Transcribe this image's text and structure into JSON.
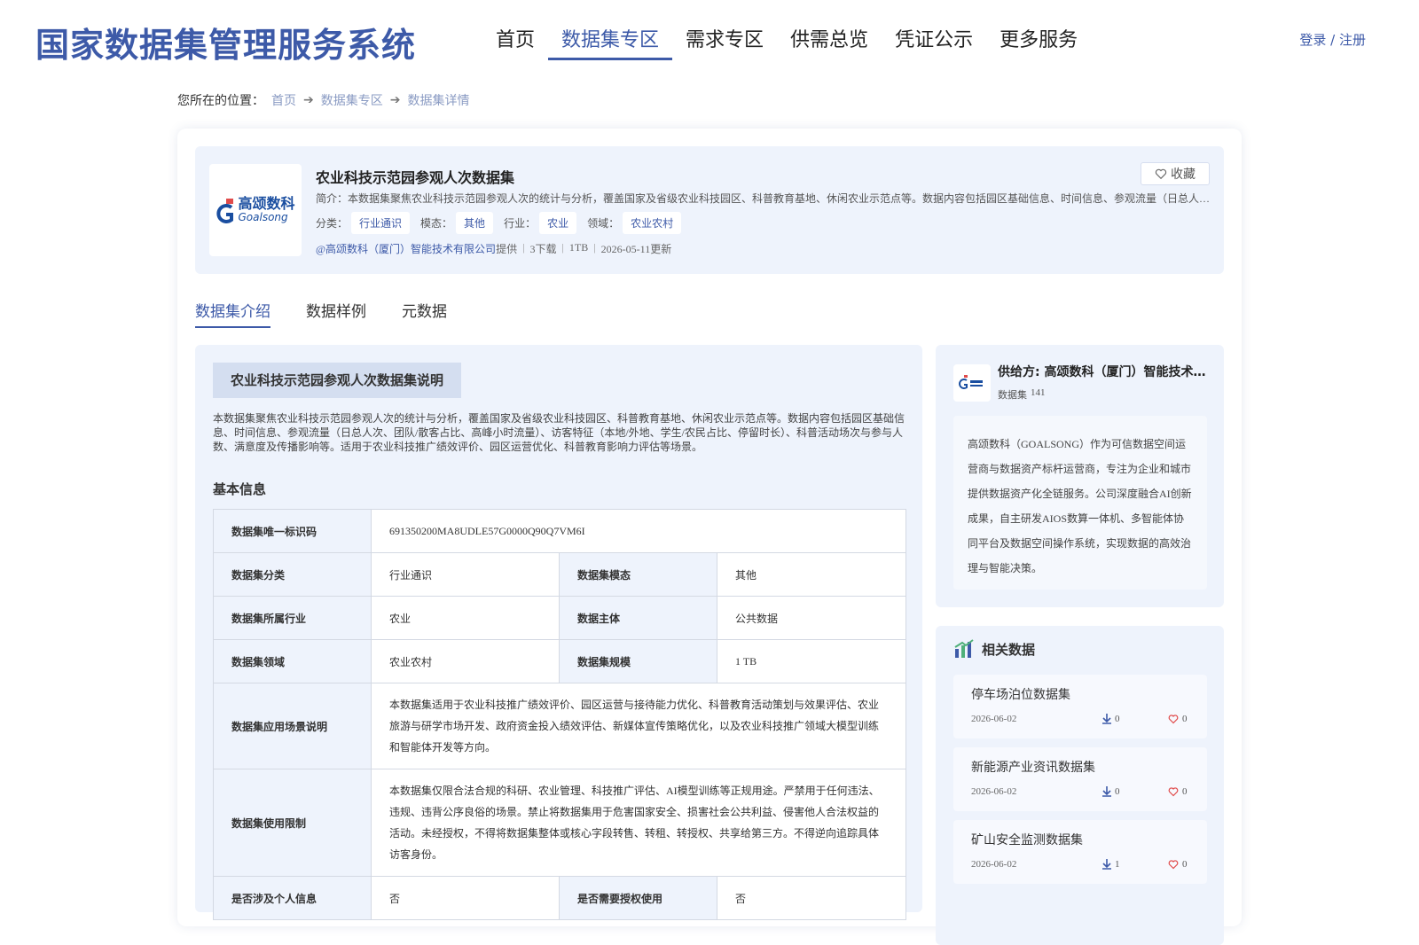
{
  "header": {
    "site_title": "国家数据集管理服务系统",
    "nav": [
      "首页",
      "数据集专区",
      "需求专区",
      "供需总览",
      "凭证公示",
      "更多服务"
    ],
    "active_nav": 1,
    "login": "登录 / 注册"
  },
  "breadcrumb": {
    "prefix": "您所在的位置：",
    "items": [
      "首页",
      "数据集专区",
      "数据集详情"
    ]
  },
  "dataset": {
    "logo_cn": "高颂数科",
    "logo_en": "Goalsong",
    "title": "农业科技示范园参观人次数据集",
    "fav_label": "收藏",
    "intro": "简介：本数据集聚焦农业科技示范园参观人次的统计与分析，覆盖国家及省级农业科技园区、科普教育基地、休闲农业示范点等。数据内容包括园区基础信息、时间信息、参观流量（日总人次、团队/散客占比、高峰小时流量）、访客特征（本地/外地、学生/农民占比、停留时长）、科普活动场次与参与人数、满意度及传播影响等。",
    "tags": [
      {
        "label": "分类：",
        "value": "行业通识"
      },
      {
        "label": "模态：",
        "value": "其他"
      },
      {
        "label": "行业：",
        "value": "农业"
      },
      {
        "label": "领域：",
        "value": "农业农村"
      }
    ],
    "provider": "@高颂数科（厦门）智能技术有限公司",
    "provider_suffix": "提供",
    "downloads": "3下载",
    "size": "1TB",
    "updated": "2026-05-11更新"
  },
  "tabs": [
    "数据集介绍",
    "数据样例",
    "元数据"
  ],
  "active_tab": 0,
  "intro_section": {
    "heading": "农业科技示范园参观人次数据集说明",
    "description": "本数据集聚焦农业科技示范园参观人次的统计与分析，覆盖国家及省级农业科技园区、科普教育基地、休闲农业示范点等。数据内容包括园区基础信息、时间信息、参观流量（日总人次、团队/散客占比、高峰小时流量）、访客特征（本地/外地、学生/农民占比、停留时长）、科普活动场次与参与人数、满意度及传播影响等。适用于农业科技推广绩效评价、园区运营优化、科普教育影响力评估等场景。",
    "basic_title": "基本信息"
  },
  "basic_info": {
    "uid_label": "数据集唯一标识码",
    "uid_value": "691350200MA8UDLE57G0000Q90Q7VM6I",
    "category_label": "数据集分类",
    "category_value": "行业通识",
    "modality_label": "数据集模态",
    "modality_value": "其他",
    "industry_label": "数据集所属行业",
    "industry_value": "农业",
    "subject_label": "数据主体",
    "subject_value": "公共数据",
    "domain_label": "数据集领域",
    "domain_value": "农业农村",
    "scale_label": "数据集规模",
    "scale_value": "1 TB",
    "scenario_label": "数据集应用场景说明",
    "scenario_value": "本数据集适用于农业科技推广绩效评价、园区运营与接待能力优化、科普教育活动策划与效果评估、农业旅游与研学市场开发、政府资金投入绩效评估、新媒体宣传策略优化，以及农业科技推广领域大模型训练和智能体开发等方向。",
    "restriction_label": "数据集使用限制",
    "restriction_value": "本数据集仅限合法合规的科研、农业管理、科技推广评估、AI模型训练等正规用途。严禁用于任何违法、违规、违背公序良俗的场景。禁止将数据集用于危害国家安全、损害社会公共利益、侵害他人合法权益的活动。未经授权，不得将数据集整体或核心字段转售、转租、转授权、共享给第三方。不得逆向追踪具体访客身份。",
    "personal_label": "是否涉及个人信息",
    "personal_value": "否",
    "auth_label": "是否需要授权使用",
    "auth_value": "否"
  },
  "provider_card": {
    "name": "供给方: 高颂数科（厦门）智能技术有限公司",
    "count_label": "数据集",
    "count_value": "141",
    "description": "高颂数科（GOALSONG）作为可信数据空间运营商与数据资产标杆运营商，专注为企业和城市提供数据资产化全链服务。公司深度融合AI创新成果，自主研发AIOS数算一体机、多智能体协同平台及数据空间操作系统，实现数据的高效治理与智能决策。"
  },
  "related": {
    "title": "相关数据",
    "items": [
      {
        "name": "停车场泊位数据集",
        "date": "2026-06-02",
        "downloads": "0",
        "likes": "0"
      },
      {
        "name": "新能源产业资讯数据集",
        "date": "2026-06-02",
        "downloads": "0",
        "likes": "0"
      },
      {
        "name": "矿山安全监测数据集",
        "date": "2026-06-02",
        "downloads": "1",
        "likes": "0"
      }
    ]
  },
  "colors": {
    "primary": "#3d5aa8",
    "panel_bg": "#eef3fc",
    "accent_red": "#e04b4b"
  }
}
